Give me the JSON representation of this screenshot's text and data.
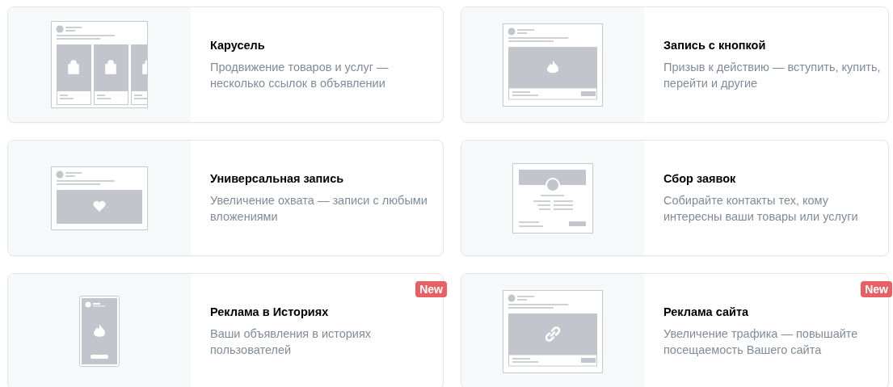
{
  "cards": [
    {
      "kind": "carousel",
      "title": "Карусель",
      "description_lines": [
        "Продвижение товаров и услуг —",
        "несколько ссылок в объявлении"
      ]
    },
    {
      "kind": "button_post",
      "title": "Запись с кнопкой",
      "description_lines": [
        "Призыв к действию — вступить, купить,",
        "перейти и другие"
      ]
    },
    {
      "kind": "universal_post",
      "title": "Универсальная запись",
      "description_lines": [
        "Увеличение охвата — записи с любыми",
        "вложениями"
      ]
    },
    {
      "kind": "lead_form",
      "title": "Сбор заявок",
      "description_lines": [
        "Собирайте контакты тех, кому",
        "интересны ваши товары или услуги"
      ]
    },
    {
      "kind": "stories",
      "title": "Реклама в Историях",
      "description_lines": [
        "Ваши объявления в историях",
        "пользователей"
      ],
      "badge": "New"
    },
    {
      "kind": "site",
      "title": "Реклама сайта",
      "description_lines": [
        "Увеличение трафика — повышайте",
        "посещаемость Вашего сайта"
      ],
      "badge": "New"
    }
  ]
}
